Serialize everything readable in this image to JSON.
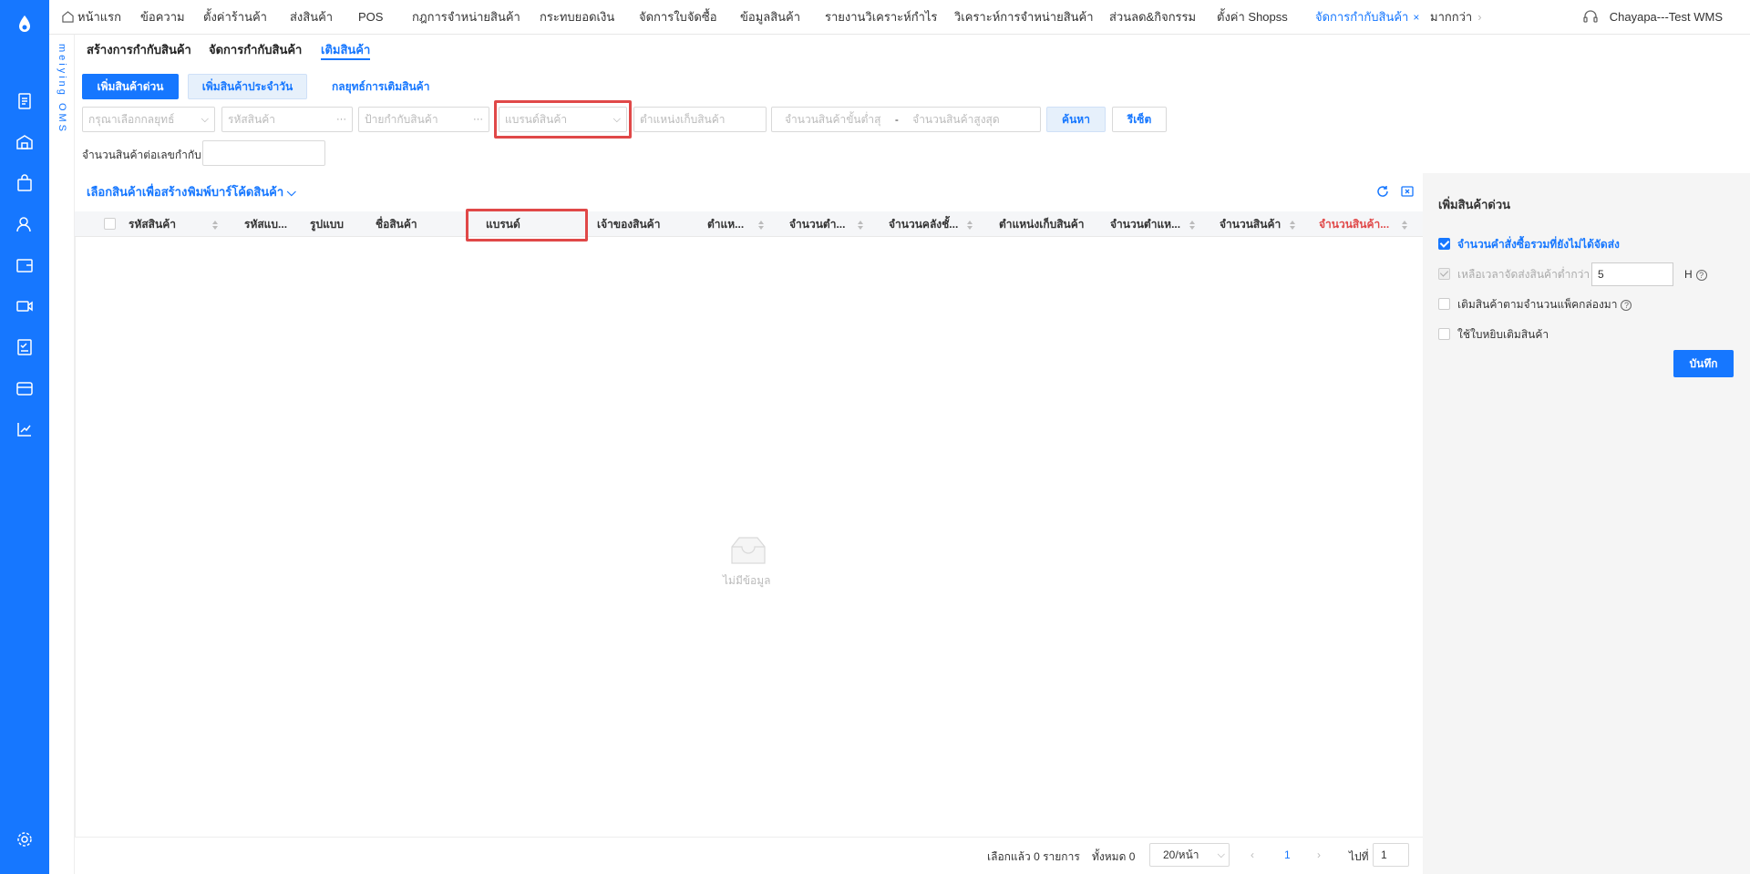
{
  "nav": {
    "home": "หน้าแรก",
    "items": [
      "ข้อความ",
      "ตั้งค่าร้านค้า",
      "ส่งสินค้า",
      "POS",
      "กฎการจำหน่ายสินค้า",
      "กระทบยอดเงิน",
      "จัดการใบจัดซื้อ",
      "ข้อมูลสินค้า",
      "รายงานวิเคราะห์กำไร",
      "วิเคราะห์การจำหน่ายสินค้า",
      "ส่วนลด&กิจกรรม",
      "ตั้งค่า Shopss"
    ],
    "active": "จัดการกำกับสินค้า",
    "close_glyph": "×",
    "more": "มากกว่า",
    "user": "Chayapa---Test WMS"
  },
  "brand_vertical": "meiying OMS",
  "subtabs": [
    "สร้างการกำกับสินค้า",
    "จัดการกำกับสินค้า",
    "เติมสินค้า"
  ],
  "buttons": {
    "quick_restock": "เพิ่มสินค้าด่วน",
    "daily_restock": "เพิ่มสินค้าประจำวัน",
    "strategy": "กลยุทธ์การเติมสินค้า",
    "search": "ค้นหา",
    "reset": "รีเซ็ต"
  },
  "filters": {
    "strategy_placeholder": "กรุณาเลือกกลยุทธ์",
    "sku_placeholder": "รหัสสินค้า",
    "label_placeholder": "ป้ายกำกับสินค้า",
    "brand_placeholder": "แบรนด์สินค้า",
    "location_placeholder": "ตำแหน่งเก็บสินค้า",
    "min_qty_placeholder": "จำนวนสินค้าขั้นต่ำสุ",
    "range_sep": "-",
    "max_qty_placeholder": "จำนวนสินค้าสูงสุด",
    "per_label_qty": "จำนวนสินค้าต่อเลขกำกับ",
    "ellipsis": "···"
  },
  "toolbar": {
    "select_create": "เลือกสินค้าเพื่อสร้าง",
    "print_barcode": "พิมพ์บาร์โค้ดสินค้า"
  },
  "table": {
    "columns": [
      "รหัสสินค้า",
      "รหัสแบ...",
      "รูปแบบ",
      "ชื่อสินค้า",
      "แบรนด์",
      "เจ้าของสินค้า",
      "ตำแห...",
      "จำนวนตำ...",
      "จำนวนคลังชั้...",
      "ตำแหน่งเก็บสินค้า",
      "จำนวนตำแห...",
      "จำนวนสินค้า",
      "จำนวนสินค้า..."
    ],
    "empty": "ไม่มีข้อมูล",
    "highlight_color": "#e04848",
    "accent": "#1677ff"
  },
  "pager": {
    "selected": "เลือกแล้ว 0 รายการ",
    "total": "ทั้งหมด 0",
    "page_size": "20/หน้า",
    "current": "1",
    "goto_label": "ไปที่",
    "goto_value": "1"
  },
  "panel": {
    "title": "เพิ่มสินค้าด่วน",
    "opt1": "จำนวนคำสั่งซื้อรวมที่ยังไม่ได้จัดส่ง",
    "opt2": "เหลือเวลาจัดส่งสินค้าต่ำกว่า",
    "opt2_value": "5",
    "opt2_unit": "H",
    "opt3": "เติมสินค้าตามจำนวนแพ็คกล่องมา",
    "opt4": "ใช้ใบหยิบเติมสินค้า",
    "save": "บันทึก",
    "help": "?"
  }
}
